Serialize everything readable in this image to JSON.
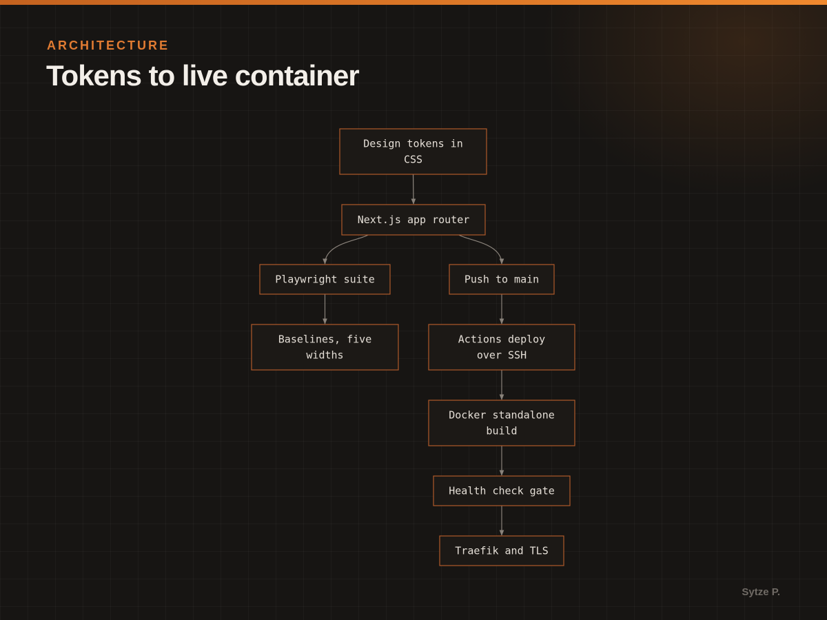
{
  "header": {
    "eyebrow": "ARCHITECTURE",
    "title": "Tokens to live container"
  },
  "footer": {
    "author": "Sytze P."
  },
  "diagram": {
    "nodes": [
      {
        "id": "tokens",
        "lines": [
          "Design tokens in",
          "CSS"
        ]
      },
      {
        "id": "router",
        "lines": [
          "Next.js app router"
        ]
      },
      {
        "id": "playwright",
        "lines": [
          "Playwright suite"
        ]
      },
      {
        "id": "push",
        "lines": [
          "Push to main"
        ]
      },
      {
        "id": "baselines",
        "lines": [
          "Baselines, five",
          "widths"
        ]
      },
      {
        "id": "actions",
        "lines": [
          "Actions deploy",
          "over SSH"
        ]
      },
      {
        "id": "docker",
        "lines": [
          "Docker standalone",
          "build"
        ]
      },
      {
        "id": "health",
        "lines": [
          "Health check gate"
        ]
      },
      {
        "id": "traefik",
        "lines": [
          "Traefik and TLS"
        ]
      }
    ],
    "edges": [
      {
        "from": "tokens",
        "to": "router"
      },
      {
        "from": "router",
        "to": "playwright"
      },
      {
        "from": "router",
        "to": "push"
      },
      {
        "from": "playwright",
        "to": "baselines"
      },
      {
        "from": "push",
        "to": "actions"
      },
      {
        "from": "actions",
        "to": "docker"
      },
      {
        "from": "docker",
        "to": "health"
      },
      {
        "from": "health",
        "to": "traefik"
      }
    ]
  },
  "colors": {
    "accent": "#e07b32",
    "node_border": "#b0592a",
    "node_fill": "#1c1916",
    "edge": "#8a837b",
    "background": "#171513"
  }
}
